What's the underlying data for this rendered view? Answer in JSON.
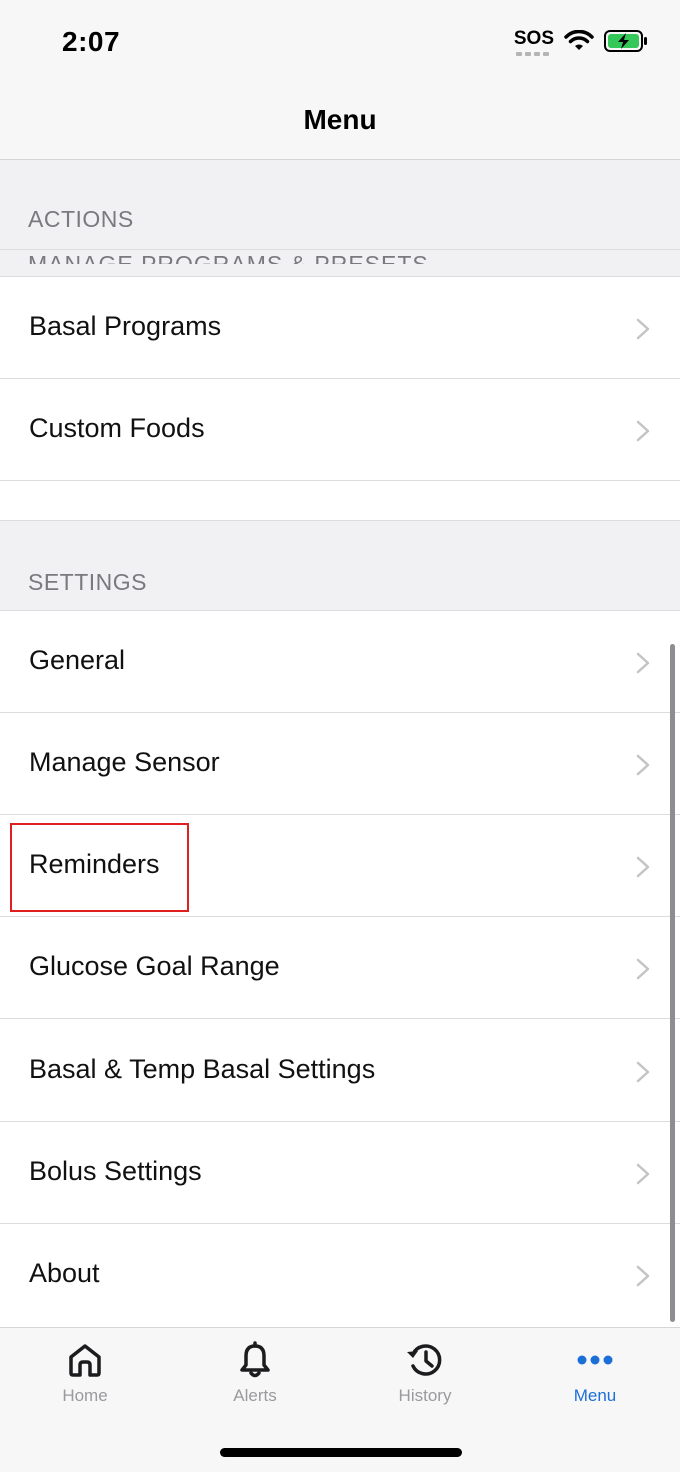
{
  "status_bar": {
    "time": "2:07",
    "sos": "SOS"
  },
  "header": {
    "title": "Menu"
  },
  "sections": {
    "actions": {
      "title": "ACTIONS",
      "subheader": "MANAGE PROGRAMS & PRESETS",
      "items": [
        {
          "label": "Basal Programs"
        },
        {
          "label": "Custom Foods"
        }
      ]
    },
    "settings": {
      "title": "SETTINGS",
      "items": [
        {
          "label": "General"
        },
        {
          "label": "Manage Sensor"
        },
        {
          "label": "Reminders"
        },
        {
          "label": "Glucose Goal Range"
        },
        {
          "label": "Basal & Temp Basal Settings"
        },
        {
          "label": "Bolus Settings"
        },
        {
          "label": "About"
        }
      ]
    }
  },
  "tabs": [
    {
      "label": "Home",
      "icon": "home-icon"
    },
    {
      "label": "Alerts",
      "icon": "bell-icon"
    },
    {
      "label": "History",
      "icon": "history-icon"
    },
    {
      "label": "Menu",
      "icon": "more-dots-icon",
      "active": true
    }
  ],
  "colors": {
    "accent": "#1d6fd8",
    "highlight": "#e02020",
    "section_bg": "#f1f1f4"
  }
}
